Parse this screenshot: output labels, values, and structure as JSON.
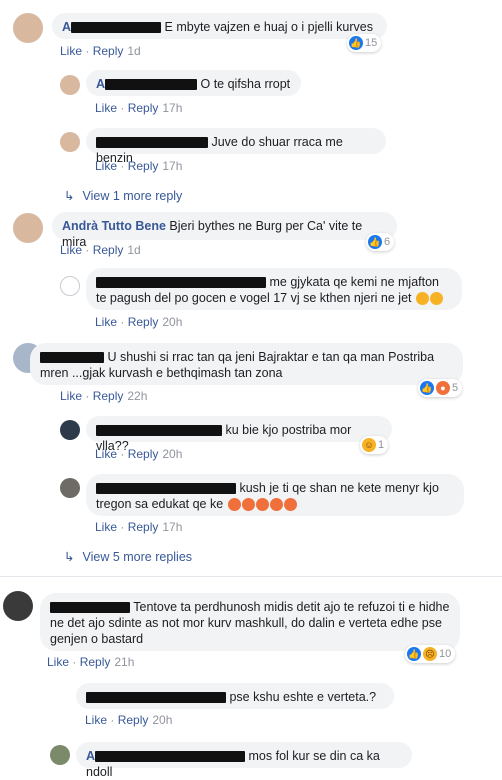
{
  "comments": [
    {
      "name": "",
      "text": "E mbyte vajzen e huaj o i pjelli kurves",
      "like": "Like",
      "reply": "Reply",
      "time": "1d",
      "reacts": "15"
    },
    {
      "name": "",
      "text": "O te qifsha rropt",
      "like": "Like",
      "reply": "Reply",
      "time": "17h"
    },
    {
      "name": "",
      "text": "Juve do shuar rraca me benzin",
      "like": "Like",
      "reply": "Reply",
      "time": "17h"
    },
    {
      "more": "View 1 more reply"
    },
    {
      "name": "Andrà Tutto Bene",
      "text": "Bjeri bythes ne Burg per Ca' vite te mira",
      "like": "Like",
      "reply": "Reply",
      "time": "1d",
      "reacts": "6"
    },
    {
      "name": "",
      "text": "me gjykata qe kemi ne mjafton te pagush del po gocen e vogel 17 vj se kthen njeri ne jet",
      "like": "Like",
      "reply": "Reply",
      "time": "20h"
    },
    {
      "name": "",
      "text": "U shushi si rrac tan qa jeni Bajraktar e tan qa man Postriba mren ...gjak kurvash e bethqimash tan zona",
      "like": "Like",
      "reply": "Reply",
      "time": "22h",
      "reacts": "5"
    },
    {
      "name": "",
      "text": "ku bie kjo postriba mor vlla??",
      "like": "Like",
      "reply": "Reply",
      "time": "20h",
      "reacts": "1"
    },
    {
      "name": "",
      "text": "kush je ti qe shan ne kete menyr kjo tregon sa edukat qe ke",
      "like": "Like",
      "reply": "Reply",
      "time": "17h"
    },
    {
      "more": "View 5 more replies"
    },
    {
      "name": "",
      "text": "Tentove ta perdhunosh midis detit ajo te refuzoi ti e hidhe ne det ajo sdinte as not mor kurv mashkull, do dalin e verteta edhe pse genjen o bastard",
      "like": "Like",
      "reply": "Reply",
      "time": "21h",
      "reacts": "10"
    },
    {
      "name": "",
      "text": "pse kshu eshte e verteta.?",
      "like": "Like",
      "reply": "Reply",
      "time": "20h"
    },
    {
      "name": "",
      "text": "mos fol kur se din ca ka ndoll"
    }
  ],
  "icons": {
    "like": "like-icon",
    "angry": "angry-icon",
    "haha": "haha-icon",
    "sad": "sad-icon",
    "reply_arrow": "reply-arrow-icon"
  },
  "colors": {
    "link": "#385898",
    "bubble": "#f2f3f5",
    "like": "#1877f2",
    "angry": "#f0703c"
  }
}
